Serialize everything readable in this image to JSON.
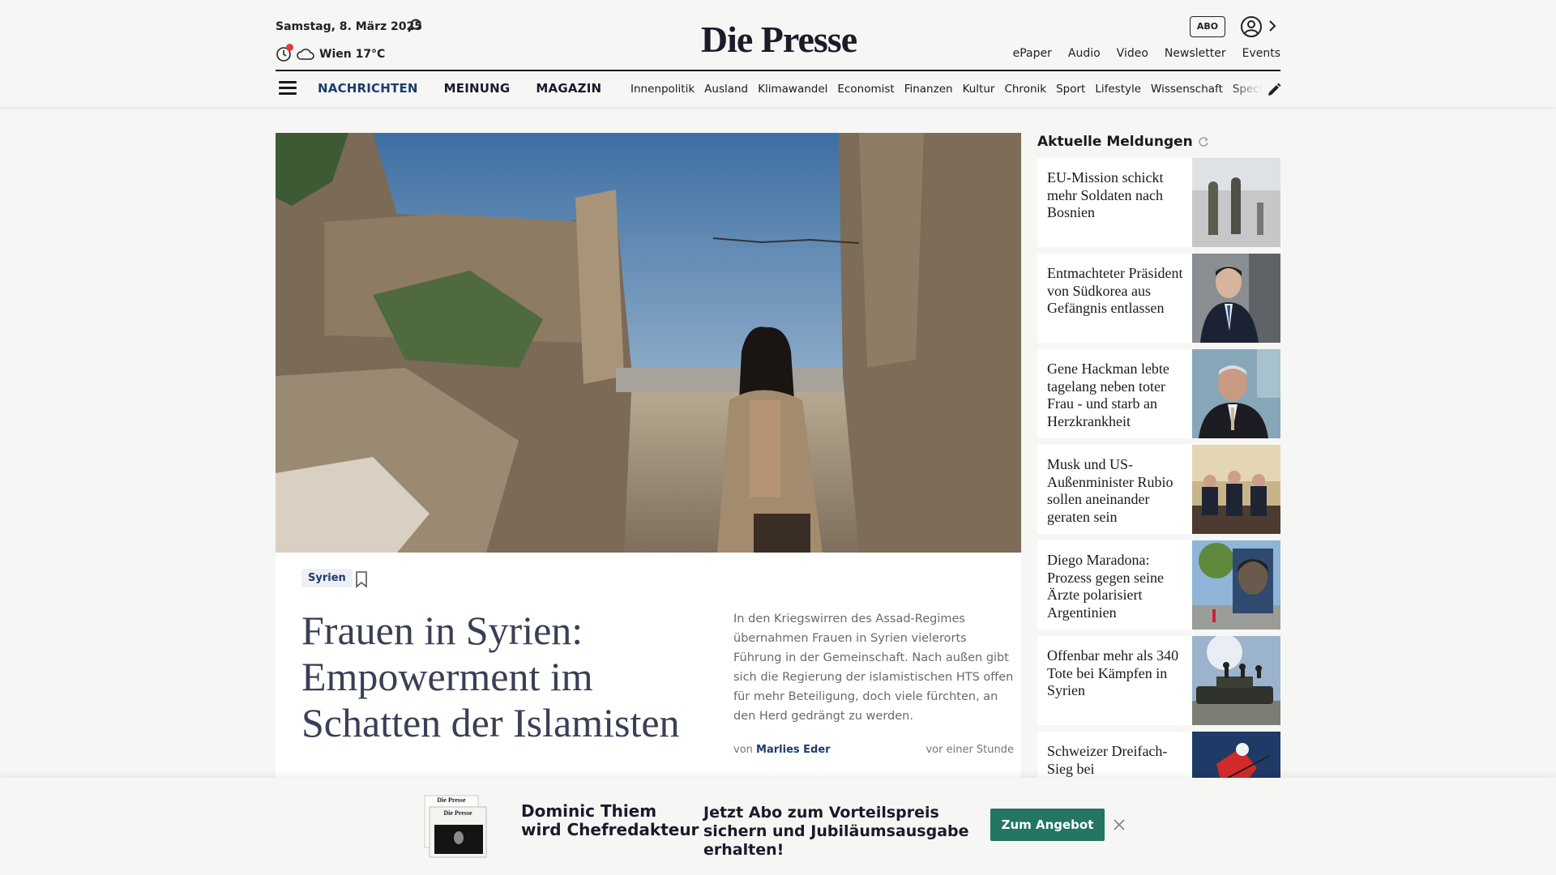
{
  "header": {
    "date": "Samstag, 8. März 2025",
    "weather": "Wien 17°C",
    "logo": "Die Presse",
    "abo_label": "ABO",
    "top_links": [
      "ePaper",
      "Audio",
      "Video",
      "Newsletter",
      "Events"
    ],
    "icons": [
      "search-icon",
      "clock-icon",
      "cloud-icon",
      "user-icon",
      "chevron-right-icon",
      "menu-icon",
      "pencil-icon"
    ]
  },
  "nav": {
    "main": [
      "NACHRICHTEN",
      "MEINUNG",
      "MAGAZIN"
    ],
    "active": "NACHRICHTEN",
    "sub": [
      "Innenpolitik",
      "Ausland",
      "Klimawandel",
      "Economist",
      "Finanzen",
      "Kultur",
      "Chronik",
      "Sport",
      "Lifestyle",
      "Wissenschaft",
      "Spectrum"
    ]
  },
  "article": {
    "tag": "Syrien",
    "headline": "Frauen in Syrien: Empowerment im Schatten der Islamisten",
    "teaser": "In den Kriegswirren des Assad-Regimes übernahmen Frauen in Syrien vielerorts Führung in der Gemeinschaft. Nach außen gibt sich die Regierung der islamistischen HTS offen für mehr Beteiligung, doch viele fürchten, an den Herd gedrängt zu werden.",
    "byline_prefix": "von",
    "author": "Marlies Eder",
    "time": "vor einer Stunde"
  },
  "sidebar": {
    "title": "Aktuelle Meldungen",
    "items": [
      {
        "text": "EU-Mission schickt mehr Soldaten nach Bosnien"
      },
      {
        "text": "Entmachteter Präsident von Südkorea aus Gefängnis entlassen"
      },
      {
        "text": "Gene Hackman lebte tagelang neben toter Frau - und starb an Herzkrankheit"
      },
      {
        "text": "Musk und US-Außenminister Rubio sollen aneinander geraten sein"
      },
      {
        "text": "Diego Maradona: Prozess gegen seine Ärzte polarisiert Argentinien"
      },
      {
        "text": "Offenbar mehr als 340 Tote bei Kämpfen in Syrien"
      },
      {
        "text": "Schweizer Dreifach-Sieg bei"
      }
    ]
  },
  "promo": {
    "title": "Dominic Thiem wird Chefredakteur",
    "text": "Jetzt Abo zum Vorteilspreis sichern und Jubiläumsausgabe erhalten!",
    "button": "Zum Angebot",
    "image_mini_logo": "Die Presse"
  },
  "colors": {
    "brand_blue": "#1d3c6d",
    "promo_green": "#237564",
    "notification_red": "#e53a3a"
  }
}
